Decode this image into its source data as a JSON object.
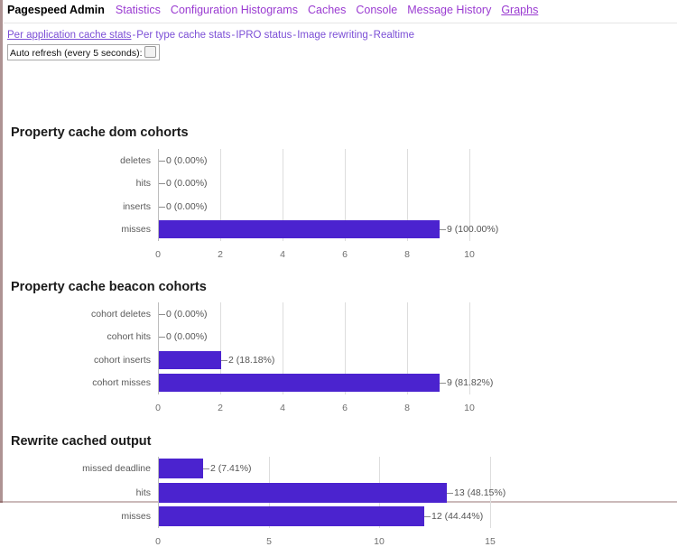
{
  "topnav": {
    "brand": "Pagespeed Admin",
    "items": [
      {
        "label": "Statistics",
        "current": false
      },
      {
        "label": "Configuration Histograms",
        "current": false
      },
      {
        "label": "Caches",
        "current": false
      },
      {
        "label": "Console",
        "current": false
      },
      {
        "label": "Message History",
        "current": false
      },
      {
        "label": "Graphs",
        "current": true
      }
    ]
  },
  "subnav": {
    "separator": "-",
    "items": [
      {
        "label": "Per application cache stats",
        "current": true
      },
      {
        "label": "Per type cache stats",
        "current": false
      },
      {
        "label": "IPRO status",
        "current": false
      },
      {
        "label": "Image rewriting",
        "current": false
      },
      {
        "label": "Realtime",
        "current": false
      }
    ],
    "auto_refresh_label": "Auto refresh (every 5 seconds):",
    "auto_refresh_checked": false
  },
  "colors": {
    "bar": "#4b23cf",
    "nav_link": "#9a3bd1",
    "subnav_link": "#7b4ed6",
    "gridline": "#dddddd",
    "axis": "#bdbdbd"
  },
  "chart_data": [
    {
      "type": "bar",
      "orientation": "horizontal",
      "title": "Property cache dom cohorts",
      "xlabel": "",
      "ylabel": "",
      "xlim": [
        0,
        11
      ],
      "xticks": [
        0,
        2,
        4,
        6,
        8,
        10
      ],
      "grid": true,
      "legend": false,
      "categories": [
        "deletes",
        "hits",
        "inserts",
        "misses"
      ],
      "values": [
        0,
        0,
        0,
        9
      ],
      "percents": [
        "0.00%",
        "0.00%",
        "0.00%",
        "100.00%"
      ],
      "data_labels": [
        "0 (0.00%)",
        "0 (0.00%)",
        "0 (0.00%)",
        "9 (100.00%)"
      ]
    },
    {
      "type": "bar",
      "orientation": "horizontal",
      "title": "Property cache beacon cohorts",
      "xlabel": "",
      "ylabel": "",
      "xlim": [
        0,
        11
      ],
      "xticks": [
        0,
        2,
        4,
        6,
        8,
        10
      ],
      "grid": true,
      "legend": false,
      "categories": [
        "cohort deletes",
        "cohort hits",
        "cohort inserts",
        "cohort misses"
      ],
      "values": [
        0,
        0,
        2,
        9
      ],
      "percents": [
        "0.00%",
        "0.00%",
        "18.18%",
        "81.82%"
      ],
      "data_labels": [
        "0 (0.00%)",
        "0 (0.00%)",
        "2 (18.18%)",
        "9 (81.82%)"
      ]
    },
    {
      "type": "bar",
      "orientation": "horizontal",
      "title": "Rewrite cached output",
      "xlabel": "",
      "ylabel": "",
      "xlim": [
        0,
        15.5
      ],
      "xticks": [
        0,
        5,
        10,
        15
      ],
      "grid": true,
      "legend": false,
      "categories": [
        "missed deadline",
        "hits",
        "misses"
      ],
      "values": [
        2,
        13,
        12
      ],
      "percents": [
        "7.41%",
        "48.15%",
        "44.44%"
      ],
      "data_labels": [
        "2 (7.41%)",
        "13 (48.15%)",
        "12 (44.44%)"
      ]
    }
  ]
}
